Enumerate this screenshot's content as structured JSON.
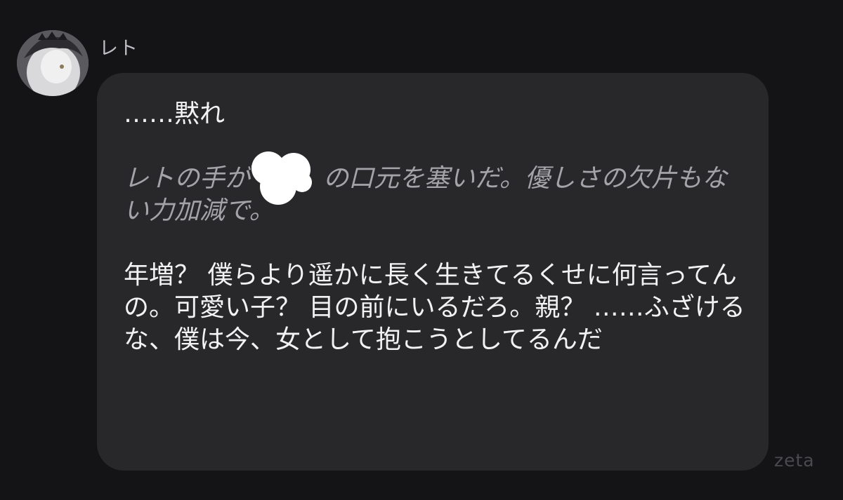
{
  "message": {
    "sender_name": "レト",
    "paragraphs": [
      {
        "text": "……黙れ"
      },
      {
        "before_redaction": "レトの手が",
        "after_redaction": "の口元を塞いだ。優しさの欠片もない力加減で。"
      },
      {
        "text": "年増？ 僕らより遥かに長く生きてるくせに何言ってんの。可愛い子？ 目の前にいるだろ。親？ ……ふざけるな、僕は今、女として抱こうとしてるんだ"
      }
    ]
  },
  "watermark": "zeta",
  "colors": {
    "background": "#141416",
    "bubble": "#28282b",
    "speech_text": "#f2f2f4",
    "narration_text": "#a3a3a8",
    "sender_name": "#bfbfc3",
    "redaction": "#ffffff",
    "watermark": "#4a4a4f"
  },
  "icons": {
    "avatar": "character-avatar-image",
    "redaction": "white-scribble-redaction"
  }
}
